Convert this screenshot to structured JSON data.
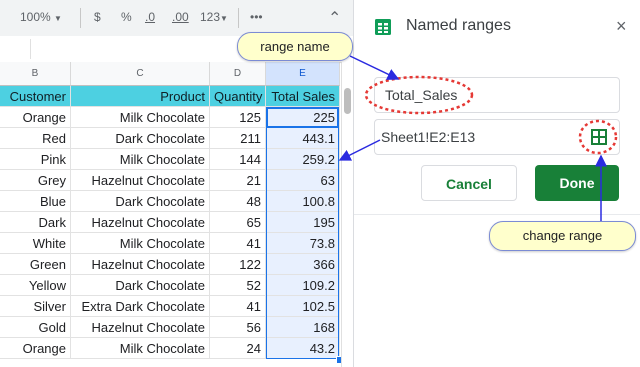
{
  "toolbar": {
    "zoom": "100%",
    "currency": "$",
    "percent": "%",
    "decrease_decimal": ".0",
    "increase_decimal": ".00",
    "format": "123",
    "more": "•••"
  },
  "columns": [
    "B",
    "C",
    "D",
    "E"
  ],
  "header": {
    "customer": "Customer",
    "product": "Product",
    "quantity": "Quantity",
    "total": "Total Sales"
  },
  "rows": [
    {
      "customer": "Orange",
      "product": "Milk Chocolate",
      "quantity": "125",
      "total": "225"
    },
    {
      "customer": "Red",
      "product": "Dark Chocolate",
      "quantity": "211",
      "total": "443.1"
    },
    {
      "customer": "Pink",
      "product": "Milk Chocolate",
      "quantity": "144",
      "total": "259.2"
    },
    {
      "customer": "Grey",
      "product": "Hazelnut Chocolate",
      "quantity": "21",
      "total": "63"
    },
    {
      "customer": "Blue",
      "product": "Dark Chocolate",
      "quantity": "48",
      "total": "100.8"
    },
    {
      "customer": "Dark",
      "product": "Hazelnut Chocolate",
      "quantity": "65",
      "total": "195"
    },
    {
      "customer": "White",
      "product": "Milk Chocolate",
      "quantity": "41",
      "total": "73.8"
    },
    {
      "customer": "Green",
      "product": "Hazelnut Chocolate",
      "quantity": "122",
      "total": "366"
    },
    {
      "customer": "Yellow",
      "product": "Dark Chocolate",
      "quantity": "52",
      "total": "109.2"
    },
    {
      "customer": "Silver",
      "product": "Extra Dark Chocolate",
      "quantity": "41",
      "total": "102.5"
    },
    {
      "customer": "Gold",
      "product": "Hazelnut Chocolate",
      "quantity": "56",
      "total": "168"
    },
    {
      "customer": "Orange",
      "product": "Milk Chocolate",
      "quantity": "24",
      "total": "43.2"
    }
  ],
  "panel": {
    "title": "Named ranges",
    "close": "×",
    "name_value": "Total_Sales",
    "range_value": "Sheet1!E2:E13",
    "cancel": "Cancel",
    "done": "Done"
  },
  "callouts": {
    "range_name": "range name",
    "change_range": "change range"
  },
  "colors": {
    "header_fill": "#4dd0e1",
    "selection": "#1a73e8",
    "done_green": "#188038",
    "callout_fill": "#ffffcc",
    "annotation_red": "#e53935",
    "arrow_blue": "#2a2ae0"
  },
  "icons": {
    "sheets_logo": "sheets-icon",
    "grid_select": "grid-icon"
  }
}
